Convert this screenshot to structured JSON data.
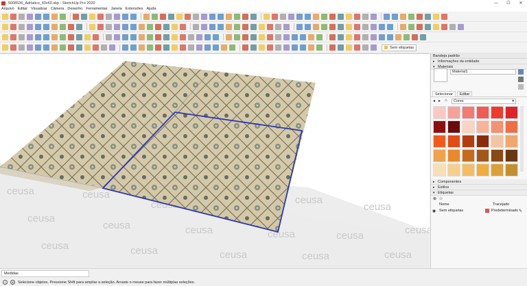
{
  "window": {
    "title": "5008536_Adriatico_60x60.skp - SketchUp Pro 2020",
    "controls": [
      "—",
      "☐",
      "✕"
    ]
  },
  "menu": [
    "Arquivo",
    "Editar",
    "Visualizar",
    "Câmera",
    "Desenho",
    "Ferramentas",
    "Janela",
    "Extensões",
    "Ajuda"
  ],
  "toolbar": {
    "tag_selector": "Sem etiquetas"
  },
  "viewport": {
    "watermark_text": "ceusa"
  },
  "tray": {
    "title": "Bandeja padrão",
    "entity_info": "Informações da entidade",
    "materials": "Materiais",
    "material_name": "Material1",
    "tab_select": "Selecionar",
    "tab_edit": "Editar",
    "library": "Cores",
    "colors": [
      "#f9c9c4",
      "#f7a19b",
      "#f47a72",
      "#f15b52",
      "#ee3a2f",
      "#e0242a",
      "#8c0e0e",
      "#6b0b0b",
      "#f9d4c3",
      "#f7b49a",
      "#f29272",
      "#ee6f45",
      "#f05a1c",
      "#e24d16",
      "#b53b10",
      "#8a2c0c",
      "#f2c6a4",
      "#f1a66f",
      "#f0a24c",
      "#e9892b",
      "#c76a1c",
      "#a3561a",
      "#8b4915",
      "#6a3711",
      "#f9dfb6",
      "#f7cf8c",
      "#f4bd63",
      "#f1ad3c",
      "#dba039",
      "#c4902f"
    ],
    "components": "Componentes",
    "styles": "Estilos",
    "tags": "Etiquetas",
    "tags_col_name": "Nome",
    "tags_col_dash": "Tracejado",
    "tag_row_name": "Sem etiquetas",
    "tag_row_dash": "Predeterminado"
  },
  "status": {
    "measurements_label": "Medidas",
    "message": "Selecione objetos. Pressione Shift para ampliar a seleção. Arraste o mouse para fazer múltiplas seleções."
  }
}
